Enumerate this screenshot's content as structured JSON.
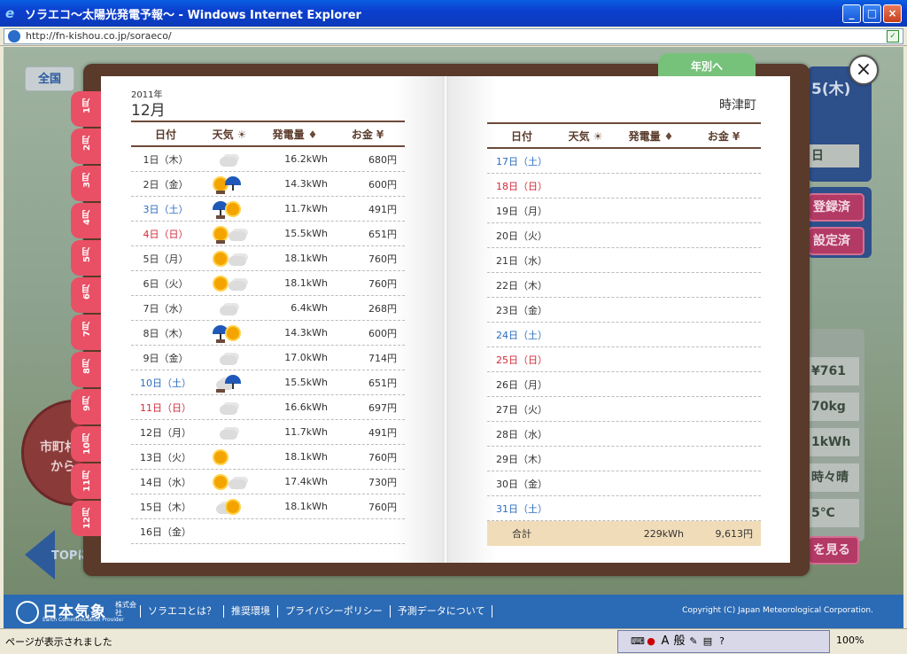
{
  "window": {
    "title": "ソラエコ〜太陽光発電予報〜 - Windows Internet Explorer",
    "buttons": [
      "_",
      "□",
      "×"
    ]
  },
  "address": {
    "url": "http://fn-kishou.co.jp/soraeco/"
  },
  "background": {
    "tab_label": "全国",
    "circle_text": [
      "市町村",
      "から"
    ],
    "top_label": "TOPに",
    "right": {
      "date_partial": "5(木)",
      "day_label": "日",
      "btn1": "登録済",
      "btn2": "設定済",
      "val1": "¥761",
      "val2": "70kg",
      "val3": "1kWh",
      "val4": "時々晴",
      "val5": "5℃",
      "btn3": "を見る"
    }
  },
  "modal": {
    "year_tab": "年別へ",
    "close": "×",
    "year": "2011年",
    "month": "12月",
    "town": "時津町",
    "months": [
      "1月",
      "2月",
      "3月",
      "4月",
      "5月",
      "6月",
      "7月",
      "8月",
      "9月",
      "10月",
      "11月",
      "12月"
    ],
    "headers": {
      "date": "日付",
      "weather": "天気",
      "power": "発電量",
      "money": "お金"
    },
    "left_rows": [
      {
        "date": "1日（木）",
        "weather": [
          "cloud"
        ],
        "power": "16.2kWh",
        "money": "680円",
        "day": "wk"
      },
      {
        "date": "2日（金）",
        "weather": [
          "sun",
          "umb",
          "arrow"
        ],
        "power": "14.3kWh",
        "money": "600円",
        "day": "wk"
      },
      {
        "date": "3日（土）",
        "weather": [
          "umb",
          "sun",
          "arrow"
        ],
        "power": "11.7kWh",
        "money": "491円",
        "day": "sat"
      },
      {
        "date": "4日（日）",
        "weather": [
          "sun",
          "cloud",
          "arrow"
        ],
        "power": "15.5kWh",
        "money": "651円",
        "day": "sun"
      },
      {
        "date": "5日（月）",
        "weather": [
          "sun",
          "cloud"
        ],
        "power": "18.1kWh",
        "money": "760円",
        "day": "wk"
      },
      {
        "date": "6日（火）",
        "weather": [
          "sun",
          "cloud"
        ],
        "power": "18.1kWh",
        "money": "760円",
        "day": "wk"
      },
      {
        "date": "7日（水）",
        "weather": [
          "cloud"
        ],
        "power": "6.4kWh",
        "money": "268円",
        "day": "wk"
      },
      {
        "date": "8日（木）",
        "weather": [
          "umb",
          "sun",
          "arrow"
        ],
        "power": "14.3kWh",
        "money": "600円",
        "day": "wk"
      },
      {
        "date": "9日（金）",
        "weather": [
          "cloud"
        ],
        "power": "17.0kWh",
        "money": "714円",
        "day": "wk"
      },
      {
        "date": "10日（土）",
        "weather": [
          "cloud",
          "umb",
          "arrow"
        ],
        "power": "15.5kWh",
        "money": "651円",
        "day": "sat"
      },
      {
        "date": "11日（日）",
        "weather": [
          "cloud"
        ],
        "power": "16.6kWh",
        "money": "697円",
        "day": "sun"
      },
      {
        "date": "12日（月）",
        "weather": [
          "cloud"
        ],
        "power": "11.7kWh",
        "money": "491円",
        "day": "wk"
      },
      {
        "date": "13日（火）",
        "weather": [
          "sun"
        ],
        "power": "18.1kWh",
        "money": "760円",
        "day": "wk"
      },
      {
        "date": "14日（水）",
        "weather": [
          "sun",
          "cloud"
        ],
        "power": "17.4kWh",
        "money": "730円",
        "day": "wk"
      },
      {
        "date": "15日（木）",
        "weather": [
          "cloud",
          "sun"
        ],
        "power": "18.1kWh",
        "money": "760円",
        "day": "wk"
      },
      {
        "date": "16日（金）",
        "weather": [],
        "power": "",
        "money": "",
        "day": "wk"
      }
    ],
    "right_rows": [
      {
        "date": "17日（土）",
        "day": "sat"
      },
      {
        "date": "18日（日）",
        "day": "sun"
      },
      {
        "date": "19日（月）",
        "day": "wk"
      },
      {
        "date": "20日（火）",
        "day": "wk"
      },
      {
        "date": "21日（水）",
        "day": "wk"
      },
      {
        "date": "22日（木）",
        "day": "wk"
      },
      {
        "date": "23日（金）",
        "day": "wk"
      },
      {
        "date": "24日（土）",
        "day": "sat"
      },
      {
        "date": "25日（日）",
        "day": "sun"
      },
      {
        "date": "26日（月）",
        "day": "wk"
      },
      {
        "date": "27日（火）",
        "day": "wk"
      },
      {
        "date": "28日（水）",
        "day": "wk"
      },
      {
        "date": "29日（木）",
        "day": "wk"
      },
      {
        "date": "30日（金）",
        "day": "wk"
      },
      {
        "date": "31日（土）",
        "day": "sat"
      }
    ],
    "total": {
      "label": "合計",
      "power": "229kWh",
      "money": "9,613円"
    }
  },
  "footer": {
    "logo": "日本気象",
    "logo_abbr": "株式会社",
    "logo_en": "Earth Communication Provider",
    "links": [
      "ソラエコとは？",
      "推奨環境",
      "プライバシーポリシー",
      "予測データについて"
    ],
    "copyright": "Copyright (C) Japan Meteorological Corporation."
  },
  "status": {
    "text": "ページが表示されました",
    "ime": [
      "A",
      "般"
    ],
    "zoom": "100%"
  }
}
